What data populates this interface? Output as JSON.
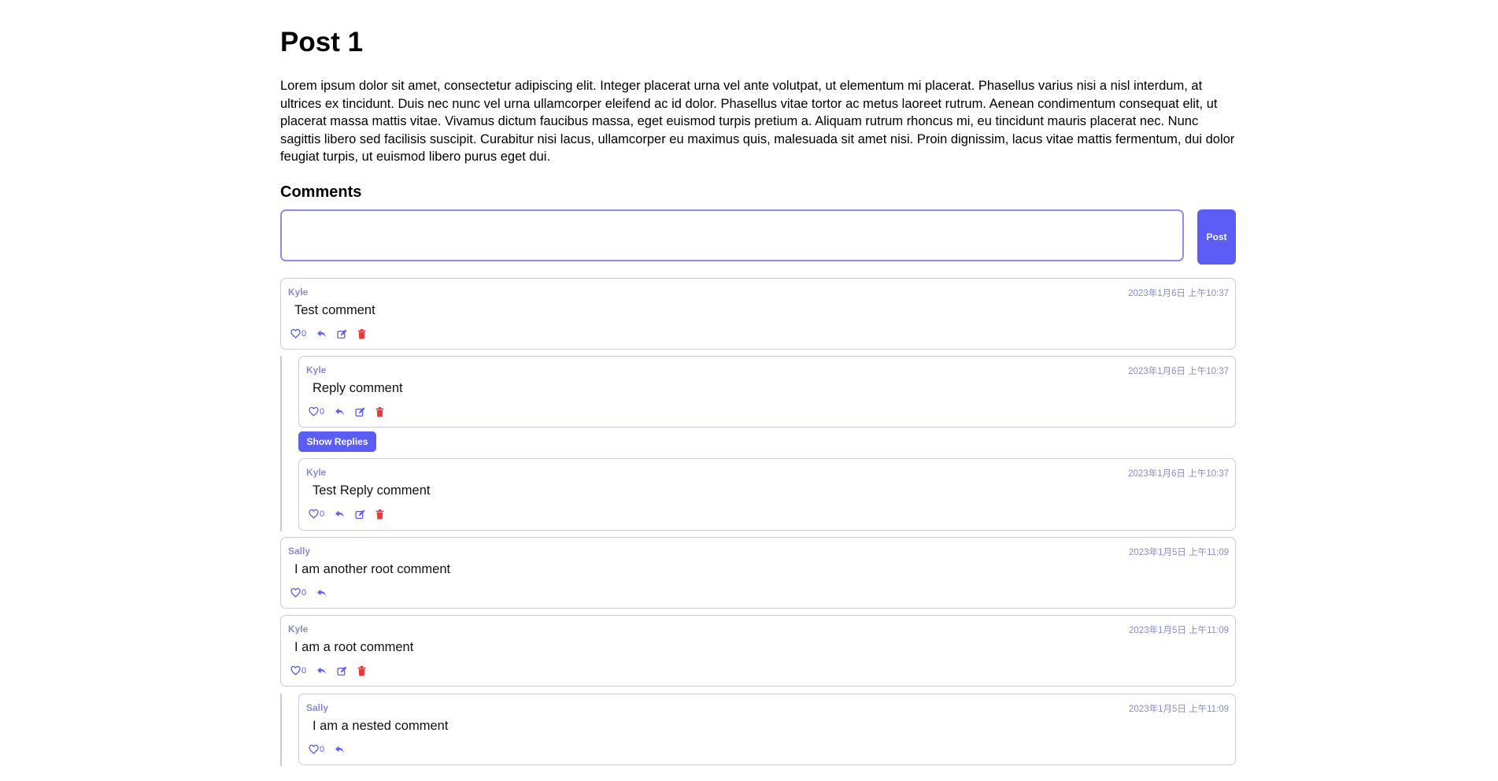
{
  "post": {
    "title": "Post 1",
    "body": "Lorem ipsum dolor sit amet, consectetur adipiscing elit. Integer placerat urna vel ante volutpat, ut elementum mi placerat. Phasellus varius nisi a nisl interdum, at ultrices ex tincidunt. Duis nec nunc vel urna ullamcorper eleifend ac id dolor. Phasellus vitae tortor ac metus laoreet rutrum. Aenean condimentum consequat elit, ut placerat massa mattis vitae. Vivamus dictum faucibus massa, eget euismod turpis pretium a. Aliquam rutrum rhoncus mi, eu tincidunt mauris placerat nec. Nunc sagittis libero sed facilisis suscipit. Curabitur nisi lacus, ullamcorper eu maximus quis, malesuada sit amet nisi. Proin dignissim, lacus vitae mattis fermentum, dui dolor feugiat turpis, ut euismod libero purus eget dui."
  },
  "comments_heading": "Comments",
  "form": {
    "input_value": "",
    "post_label": "Post"
  },
  "show_replies_label": "Show Replies",
  "colors": {
    "accent": "#5c5cf6",
    "danger": "#e83a3a",
    "meta": "#8a8ad0",
    "border": "#c9c9e6"
  },
  "icons": {
    "like": "heart-outline-icon",
    "reply": "reply-arrow-icon",
    "edit": "edit-icon",
    "delete": "trash-icon"
  },
  "comments": [
    {
      "author": "Kyle",
      "date": "2023年1月6日 上午10:37",
      "text": "Test comment",
      "likes": "0",
      "can_edit": true
    },
    {
      "author": "Kyle",
      "date": "2023年1月6日 上午10:37",
      "text": "Reply comment",
      "likes": "0",
      "can_edit": true
    },
    {
      "author": "Kyle",
      "date": "2023年1月6日 上午10:37",
      "text": "Test Reply comment",
      "likes": "0",
      "can_edit": true
    },
    {
      "author": "Sally",
      "date": "2023年1月5日 上午11:09",
      "text": "I am another root comment",
      "likes": "0",
      "can_edit": false
    },
    {
      "author": "Kyle",
      "date": "2023年1月5日 上午11:09",
      "text": "I am a root comment",
      "likes": "0",
      "can_edit": true
    },
    {
      "author": "Sally",
      "date": "2023年1月5日 上午11:09",
      "text": "I am a nested comment",
      "likes": "0",
      "can_edit": false
    }
  ]
}
